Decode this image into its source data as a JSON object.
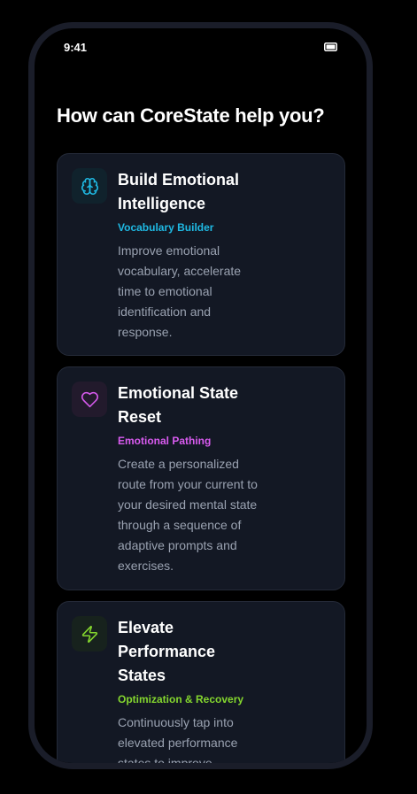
{
  "status_bar": {
    "time": "9:41",
    "battery_icon": "battery-icon"
  },
  "screen": {
    "title": "How can CoreState help you?"
  },
  "cards": [
    {
      "title": "Build Emotional Intelligence",
      "subtitle": "Vocabulary Builder",
      "description": "Improve emotional vocabulary, accelerate time to emotional identification and response.",
      "icon": "brain-icon",
      "accent": "#1fb9e3"
    },
    {
      "title": "Emotional State Reset",
      "subtitle": "Emotional Pathing",
      "description": "Create a personalized route from your current to your desired mental state through a sequence of adaptive prompts and exercises.",
      "icon": "heart-icon",
      "accent": "#d95bf0"
    },
    {
      "title": "Elevate Performance States",
      "subtitle": "Optimization & Recovery",
      "description": "Continuously tap into elevated performance states to improve",
      "icon": "lightning-icon",
      "accent": "#84d62e"
    }
  ],
  "colors": {
    "background": "#000000",
    "card_background": "#131824",
    "card_border": "#242a38",
    "phone_frame": "#1a1d29",
    "text_primary": "#ffffff",
    "text_secondary": "#9aa2b1"
  }
}
